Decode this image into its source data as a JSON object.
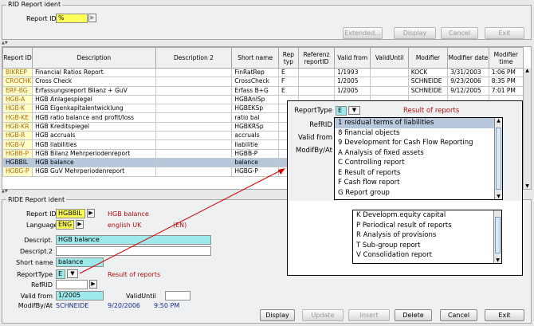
{
  "top": {
    "group_title": "RID Report ident",
    "report_id_label": "Report ID",
    "report_id_value": "%",
    "extended": "Extended...",
    "display": "Display",
    "cancel": "Cancel",
    "exit": "Exit"
  },
  "table": {
    "headers": [
      "Report ID",
      "Description",
      "Description 2",
      "Short name",
      "Rep typ",
      "Referenz reportID",
      "Valid from",
      "ValidUntil",
      "Modifier",
      "Modifier date",
      "Modifier time"
    ],
    "rows": [
      [
        "BIKREP",
        "Financial Ratios Report",
        "",
        "FinRatRep",
        "E",
        "",
        "1/1993",
        "",
        "KOCK",
        "3/31/2003",
        "1:06 PM"
      ],
      [
        "CROCHK",
        "Cross Check",
        "",
        "CrossCheck",
        "F",
        "",
        "1/2005",
        "",
        "SCHNEIDE",
        "9/23/2006",
        "8:35 PM"
      ],
      [
        "ERF-BG",
        "Erfassungsreport Bilanz + GuV",
        "",
        "Erfass B+G",
        "E",
        "",
        "1/2005",
        "",
        "SCHNEIDE",
        "9/12/2005",
        "7:01 PM"
      ],
      [
        "HGB-A",
        "HGB Anlagespiegel",
        "",
        "HGBAnlSp",
        "",
        "",
        "",
        "",
        "",
        "",
        ""
      ],
      [
        "HGB-K",
        "HGB Eigenkapitalentwicklung",
        "",
        "HGBEKSp",
        "",
        "",
        "",
        "",
        "",
        "",
        ""
      ],
      [
        "HGB-KE",
        "HGB ratio balance and profit/loss",
        "",
        "ratio bal",
        "",
        "",
        "",
        "",
        "",
        "",
        ""
      ],
      [
        "HGB-KR",
        "HGB Kreditspiegel",
        "",
        "HGBKRSp",
        "",
        "",
        "",
        "",
        "",
        "",
        ""
      ],
      [
        "HGB-R",
        "HGB accruals",
        "",
        "accruals",
        "",
        "",
        "",
        "",
        "",
        "",
        ""
      ],
      [
        "HGB-V",
        "HGB liabilities",
        "",
        "liabilitie",
        "",
        "",
        "",
        "",
        "",
        "",
        ""
      ],
      [
        "HGBB-P",
        "HGB Bilanz Mehrperiodenreport",
        "",
        "HGBB-P",
        "",
        "",
        "",
        "",
        "",
        "",
        ""
      ],
      [
        "HGBBIL",
        "HGB balance",
        "",
        "balance",
        "",
        "",
        "",
        "",
        "",
        "",
        ""
      ],
      [
        "HGBG-P",
        "HGB GuV Mehrperiodenreport",
        "",
        "HGBG-P",
        "",
        "",
        "",
        "",
        "",
        "",
        ""
      ]
    ]
  },
  "ride": {
    "group_title": "RIDE Report ident",
    "report_id_label": "Report ID",
    "report_id_value": "HGBBIL",
    "report_id_desc": "HGB balance",
    "language_label": "Language",
    "language_value": "ENG",
    "language_desc": "english UK",
    "language_code": "(EN)",
    "descript_label": "Descript.",
    "descript_value": "HGB balance",
    "descript2_label": "Descript.2",
    "shortname_label": "Short name",
    "shortname_value": "balance",
    "reporttype_label": "ReportType",
    "reporttype_value": "E",
    "reporttype_desc": "Result of reports",
    "refrid_label": "RefRID",
    "validfrom_label": "Valid from",
    "validfrom_value": "1/2005",
    "validuntil_label": "ValidUntil",
    "modif_label": "ModifBy/At",
    "modif_user": "SCHNEIDE",
    "modif_date": "9/20/2006",
    "modif_time": "9:50 PM"
  },
  "buttons": {
    "display": "Display",
    "update": "Update",
    "insert": "Insert",
    "delete": "Delete",
    "cancel": "Cancel",
    "exit": "Exit"
  },
  "zoom": {
    "reporttype_label": "ReportType",
    "reporttype_value": "E",
    "reporttype_desc": "Result of reports",
    "refrid_label": "RefRID",
    "validfrom_label": "Valid from",
    "modif_label": "ModifBy/At",
    "list1": [
      "1  residual terms of liabilities",
      "8  financial objects",
      "9  Development for Cash Flow Reporting",
      "A  Analysis of fixed assets",
      "C  Controlling report",
      "E  Result of reports",
      "F  Cash flow report",
      "G  Report group"
    ],
    "list2": [
      "K  Developm.equity capital",
      "P  Periodical result of reports",
      "R  Analysis of provisions",
      "T  Sub-group report",
      "V  Consolidation report"
    ]
  }
}
